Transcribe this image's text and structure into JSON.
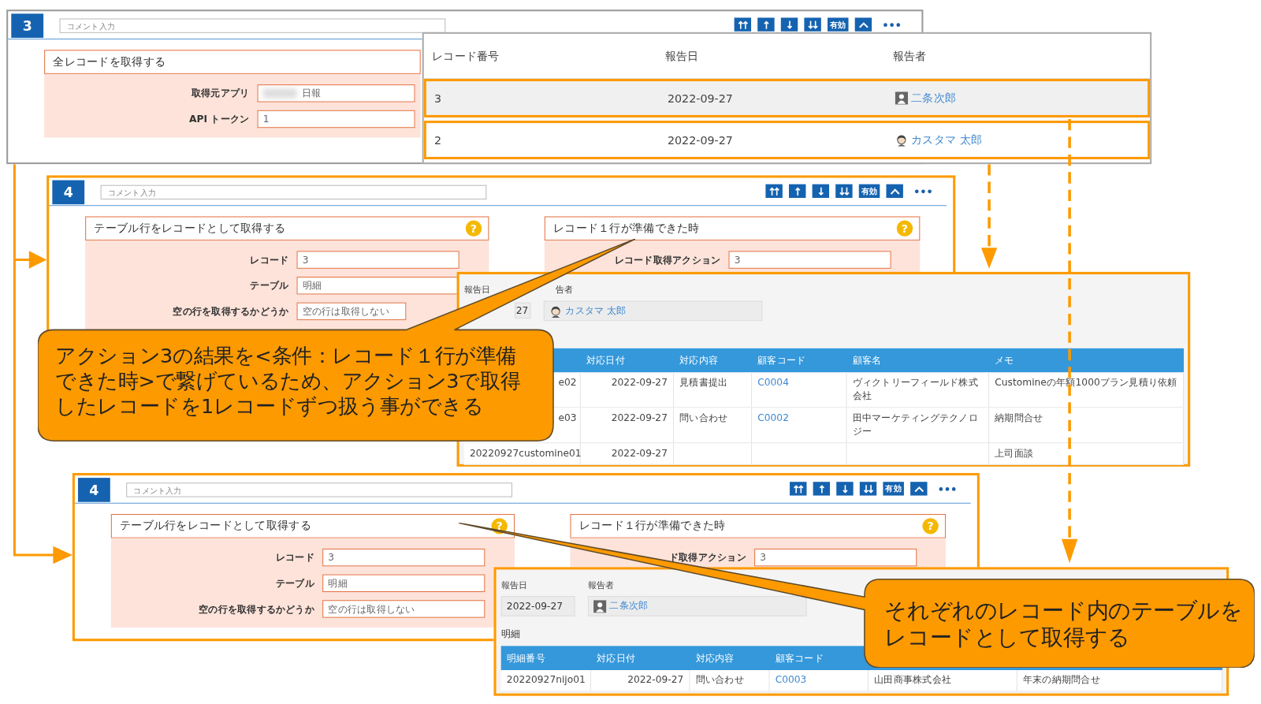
{
  "steps": [
    {
      "number": "3",
      "comment_placeholder": "コメント入力",
      "enable_label": "有効",
      "actions": [
        {
          "title": "全レコードを取得する",
          "fields": [
            {
              "label": "取得元アプリ",
              "value": "日報",
              "blurred_prefix": true
            },
            {
              "label": "API トークン",
              "value": "1"
            }
          ]
        }
      ]
    },
    {
      "number": "4",
      "comment_placeholder": "コメント入力",
      "enable_label": "有効",
      "actions": [
        {
          "title": "テーブル行をレコードとして取得する",
          "help": "?",
          "fields": [
            {
              "label": "レコード",
              "value": "3"
            },
            {
              "label": "テーブル",
              "value": "明細"
            },
            {
              "label": "空の行を取得するかどうか",
              "value": "空の行は取得しない"
            }
          ]
        },
        {
          "title": "レコード１行が準備できた時",
          "help": "?",
          "fields": [
            {
              "label": "レコード取得アクション",
              "value": "3"
            }
          ]
        }
      ]
    },
    {
      "number": "4",
      "comment_placeholder": "コメント入力",
      "enable_label": "有効",
      "actions": [
        {
          "title": "テーブル行をレコードとして取得する",
          "help": "?",
          "fields": [
            {
              "label": "レコード",
              "value": "3"
            },
            {
              "label": "テーブル",
              "value": "明細"
            },
            {
              "label": "空の行を取得するかどうか",
              "value": "空の行は取得しない"
            }
          ]
        },
        {
          "title": "レコード１行が準備できた時",
          "help": "?",
          "fields": [
            {
              "label": "ド取得アクション",
              "value": "3"
            }
          ]
        }
      ]
    }
  ],
  "record_list": {
    "columns": [
      "レコード番号",
      "報告日",
      "報告者"
    ],
    "rows": [
      {
        "number": "3",
        "date": "2022-09-27",
        "reporter": "二条次郎",
        "selected": true
      },
      {
        "number": "2",
        "date": "2022-09-27",
        "reporter": "カスタマ 太郎",
        "selected": false
      }
    ]
  },
  "record_details": [
    {
      "date_label": "報告日",
      "reporter_label": "告者",
      "date": "27",
      "reporter": "カスタマ 太郎",
      "columns": [
        {
          "kind": "text"
        },
        {
          "label": "対応日付",
          "kind": "date"
        },
        {
          "label": "対応内容",
          "kind": "text"
        },
        {
          "label": "顧客コード",
          "kind": "link"
        },
        {
          "label": "顧客名",
          "kind": "text"
        },
        {
          "label": "メモ",
          "kind": "text"
        }
      ],
      "rows": [
        [
          "e02",
          "2022-09-27",
          "見積書提出",
          "C0004",
          "ヴィクトリーフィールド株式会社",
          "Customineの年額1000プラン見積り依頼"
        ],
        [
          "e03",
          "2022-09-27",
          "問い合わせ",
          "C0002",
          "田中マーケティングテクノロジー",
          "納期問合せ"
        ],
        [
          "20220927customine01",
          "2022-09-27",
          "",
          "",
          "",
          "上司面談"
        ]
      ]
    },
    {
      "date_label": "報告日",
      "reporter_label": "報告者",
      "date": "2022-09-27",
      "reporter": "二条次郎",
      "table_label": "明細",
      "columns": [
        {
          "label": "明細番号",
          "kind": "text"
        },
        {
          "label": "対応日付",
          "kind": "date"
        },
        {
          "label": "対応内容",
          "kind": "text"
        },
        {
          "label": "顧客コード",
          "kind": "link"
        },
        {
          "kind": "text"
        },
        {
          "kind": "text"
        }
      ],
      "rows": [
        [
          "20220927nijo01",
          "2022-09-27",
          "問い合わせ",
          "C0003",
          "山田商事株式会社",
          "年末の納期問合せ"
        ]
      ]
    }
  ],
  "callouts": [
    {
      "lines": [
        "アクション3の結果を<条件：レコード１行が準備",
        "できた時>で繋げているため、アクション3で取得",
        "したレコードを1レコードずつ扱う事ができる"
      ]
    },
    {
      "lines": [
        "それぞれのレコード内のテーブルを",
        "レコードとして取得する"
      ]
    }
  ]
}
